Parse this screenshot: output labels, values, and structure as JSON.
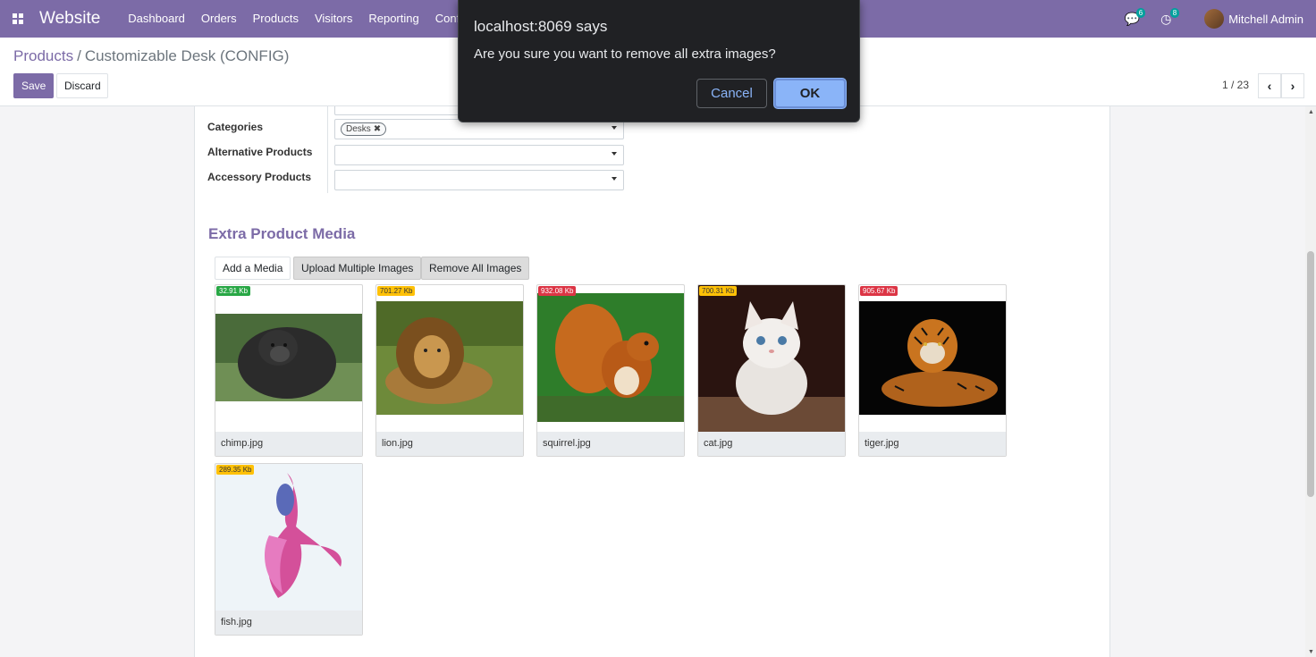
{
  "navbar": {
    "app_name": "Website",
    "menu": [
      "Dashboard",
      "Orders",
      "Products",
      "Visitors",
      "Reporting",
      "Confi"
    ],
    "messages_count": "6",
    "activities_count": "8",
    "user_name": "Mitchell Admin"
  },
  "control": {
    "breadcrumb_parent": "Products",
    "breadcrumb_sep": "/",
    "breadcrumb_current": "Customizable Desk (CONFIG)",
    "save_label": "Save",
    "discard_label": "Discard",
    "pager": "1 / 23"
  },
  "form": {
    "categories_label": "Categories",
    "categories_tag": "Desks",
    "alternative_label": "Alternative Products",
    "accessory_label": "Accessory Products"
  },
  "media": {
    "section_title": "Extra Product Media",
    "add_label": "Add a Media",
    "upload_label": "Upload Multiple Images",
    "remove_label": "Remove All Images",
    "items": [
      {
        "name": "chimp.jpg",
        "size": "32.91 Kb",
        "size_color": "#28a745"
      },
      {
        "name": "lion.jpg",
        "size": "701.27 Kb",
        "size_color": "#ffc107"
      },
      {
        "name": "squirrel.jpg",
        "size": "932.08 Kb",
        "size_color": "#dc3545"
      },
      {
        "name": "cat.jpg",
        "size": "700.31 Kb",
        "size_color": "#ffc107"
      },
      {
        "name": "tiger.jpg",
        "size": "905.67 Kb",
        "size_color": "#dc3545"
      },
      {
        "name": "fish.jpg",
        "size": "289.35 Kb",
        "size_color": "#ffc107"
      }
    ]
  },
  "dialog": {
    "title": "localhost:8069 says",
    "message": "Are you sure you want to remove all extra images?",
    "cancel_label": "Cancel",
    "ok_label": "OK"
  },
  "colors": {
    "brand": "#7c6ba7",
    "dialog_bg": "#202124",
    "ok_button": "#8ab4f8"
  }
}
